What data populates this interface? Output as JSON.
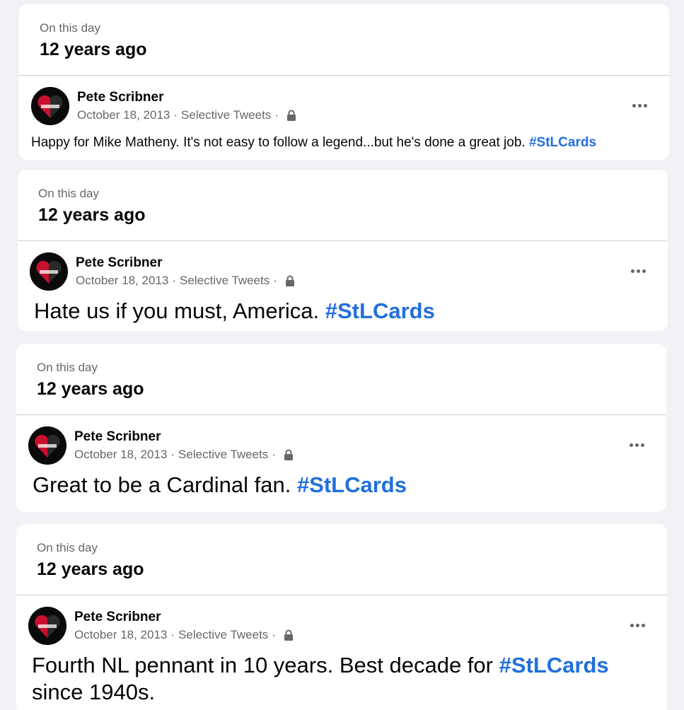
{
  "header": {
    "label": "On this day",
    "ago": "12 years ago"
  },
  "posts": [
    {
      "author": "Pete Scribner",
      "date": "October 18, 2013",
      "group": "Selective Tweets",
      "text": "Happy for Mike Matheny. It's not easy to follow a legend...but he's done a great job. ",
      "hashtag": "#StLCards",
      "text_after": ""
    },
    {
      "author": "Pete Scribner",
      "date": "October 18, 2013",
      "group": "Selective Tweets",
      "text": "Hate us if you must, America. ",
      "hashtag": "#StLCards",
      "text_after": ""
    },
    {
      "author": "Pete Scribner",
      "date": "October 18, 2013",
      "group": "Selective Tweets",
      "text": "Great to be a Cardinal fan. ",
      "hashtag": "#StLCards",
      "text_after": ""
    },
    {
      "author": "Pete Scribner",
      "date": "October 18, 2013",
      "group": "Selective Tweets",
      "text": "Fourth NL pennant in 10 years. Best decade for ",
      "hashtag": "#StLCards",
      "text_after": "since 1940s."
    }
  ],
  "meta_separator": "·",
  "icons": {
    "privacy": "lock-icon",
    "more": "more-options-icon",
    "avatar": "heart-logo-avatar"
  },
  "colors": {
    "hashtag": "#216fdb",
    "secondary": "#65676b",
    "background": "#f0f2f5"
  }
}
